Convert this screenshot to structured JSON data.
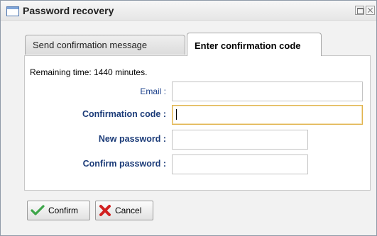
{
  "window": {
    "title": "Password recovery",
    "title_icon": "window-icon",
    "controls": [
      "maximize-icon",
      "close-icon"
    ]
  },
  "tabs": [
    {
      "label": "Send confirmation message",
      "active": false
    },
    {
      "label": "Enter confirmation code",
      "active": true
    }
  ],
  "form": {
    "remaining_text": "Remaining time: 1440 minutes.",
    "fields": [
      {
        "label": "Email :",
        "value": "",
        "focused": false
      },
      {
        "label": "Confirmation code :",
        "value": "",
        "focused": true
      },
      {
        "label": "New password :",
        "value": "",
        "focused": false
      },
      {
        "label": "Confirm password :",
        "value": "",
        "focused": false
      }
    ]
  },
  "buttons": {
    "confirm_label": "Confirm",
    "cancel_label": "Cancel",
    "confirm_icon": "checkmark-icon",
    "cancel_icon": "red-x-icon"
  },
  "colors": {
    "label_color": "#1a3f8a",
    "focus_border": "#e0b24a",
    "confirm_icon_color": "#3ea64a",
    "cancel_icon_color": "#d11f1f"
  }
}
